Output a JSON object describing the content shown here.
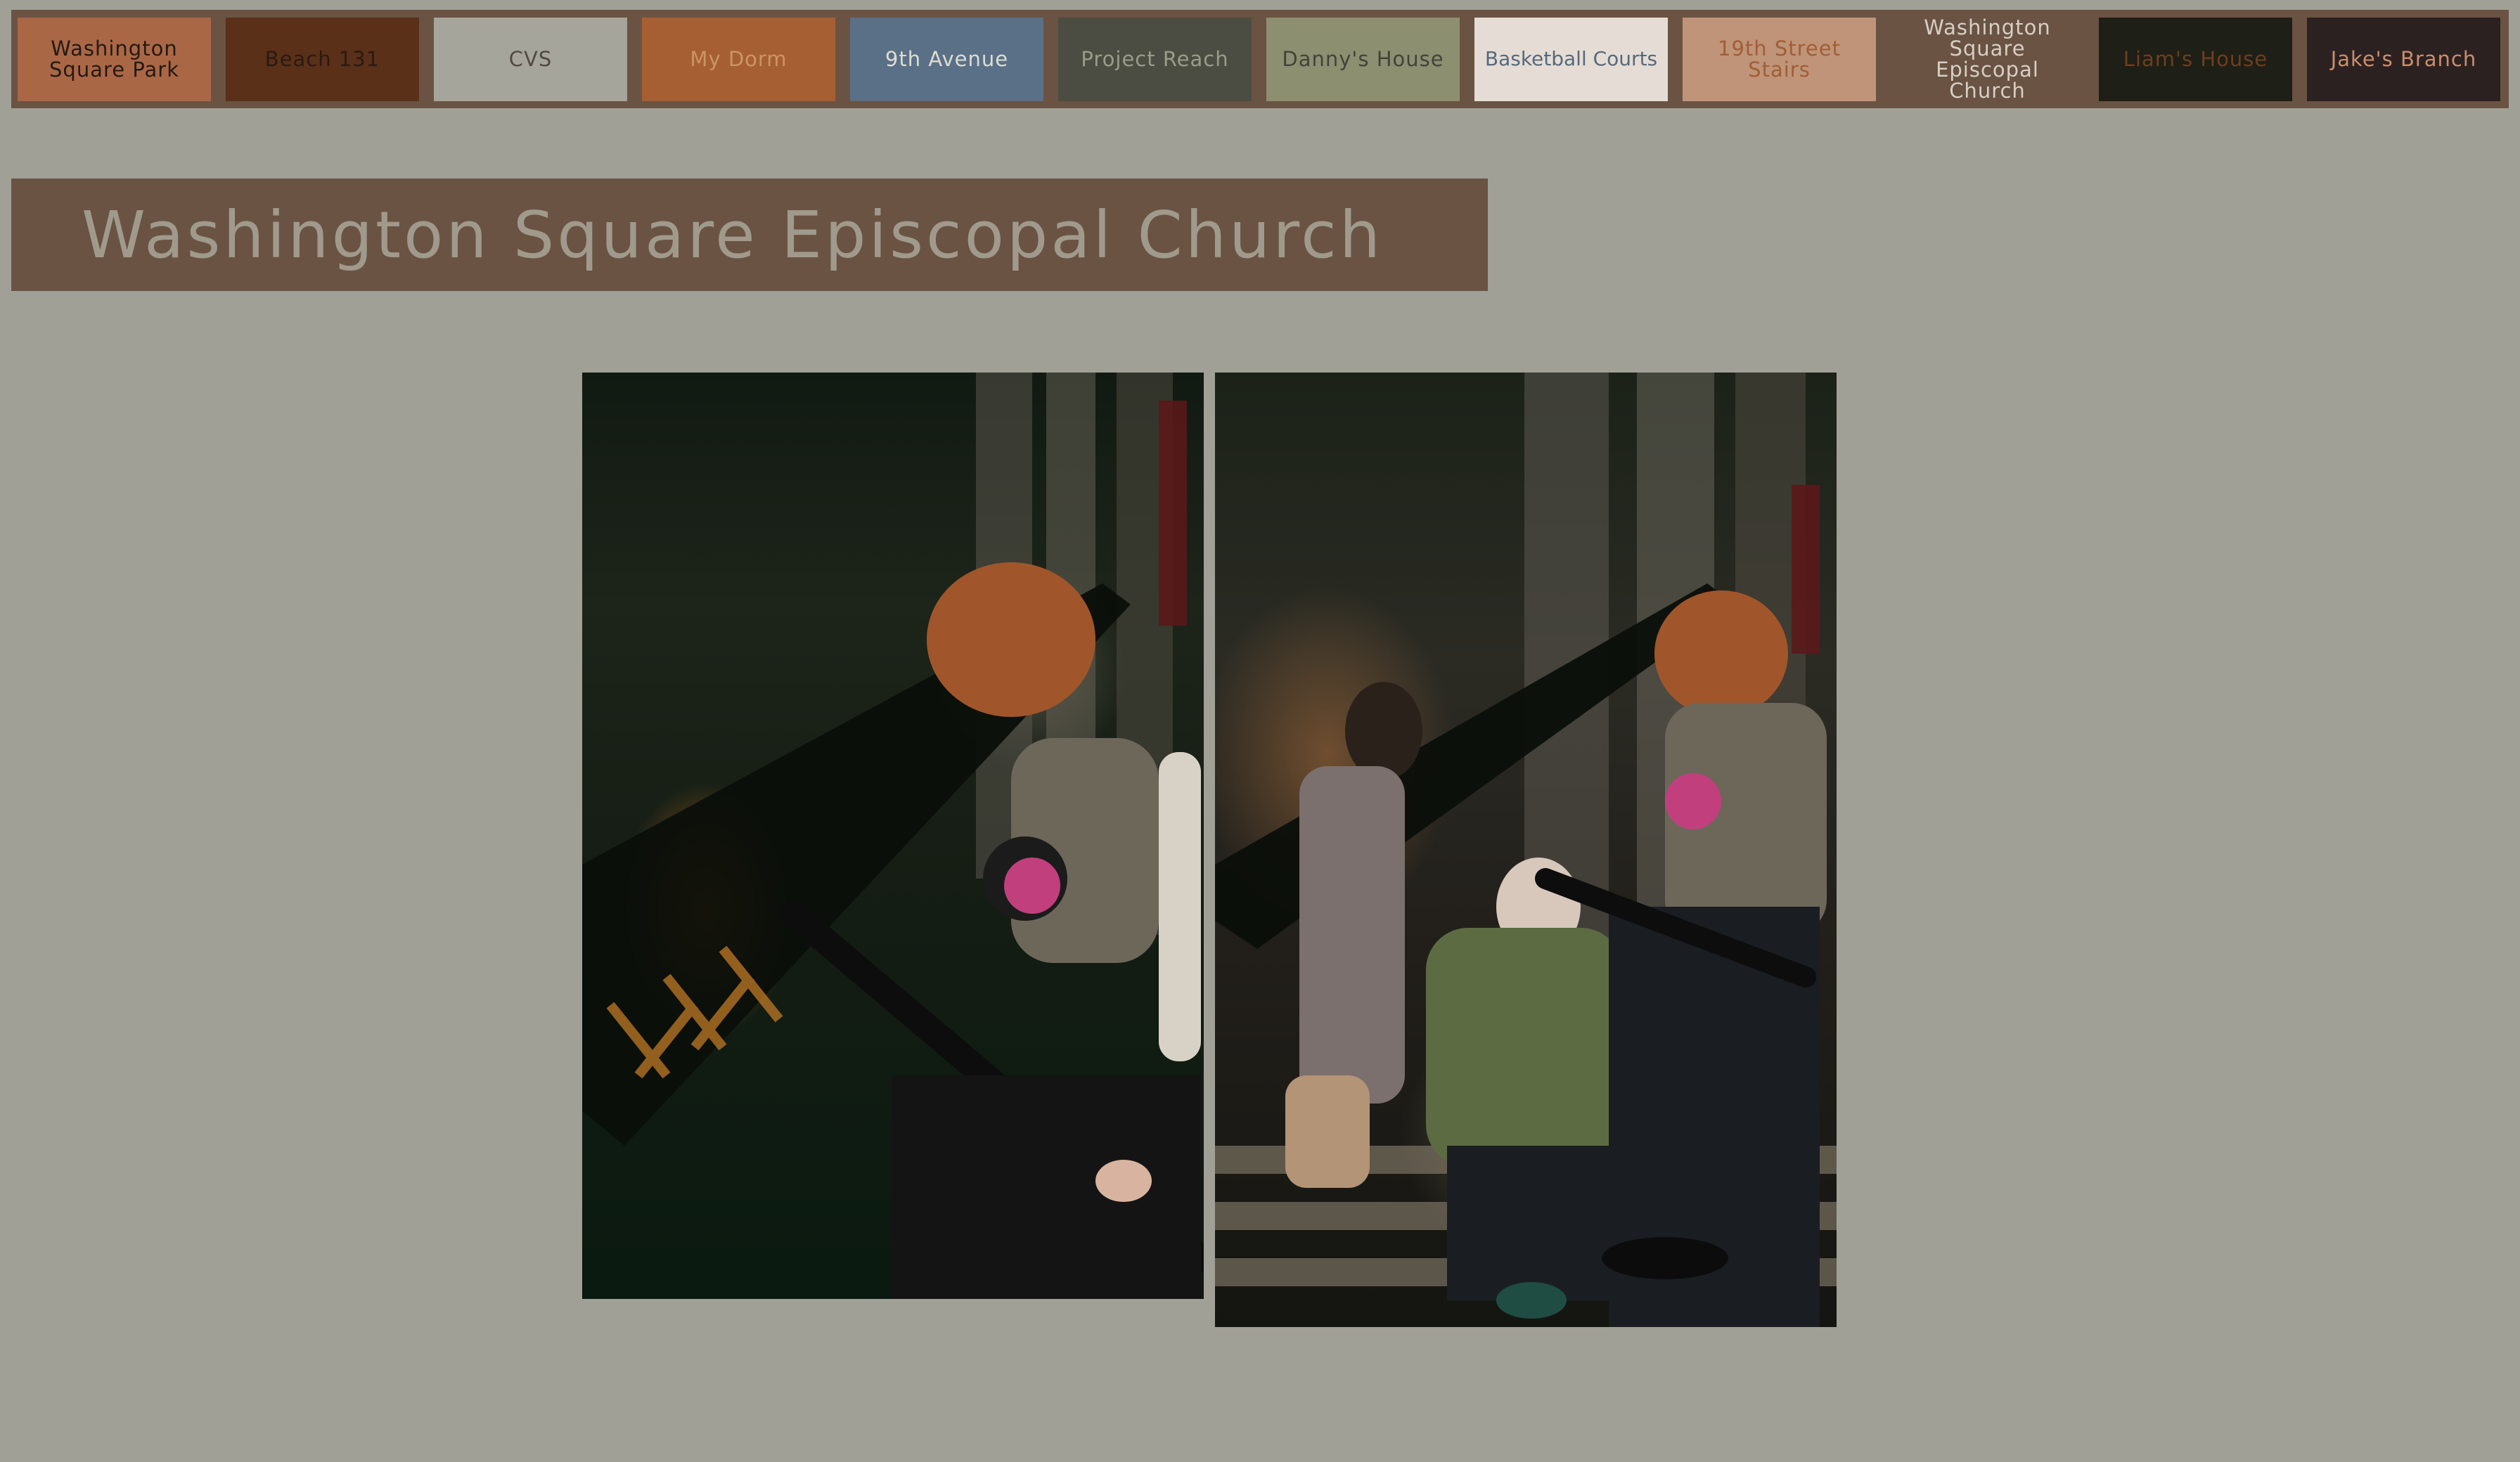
{
  "nav": {
    "items": [
      {
        "label": "Washington Square Park"
      },
      {
        "label": "Beach 131"
      },
      {
        "label": "CVS"
      },
      {
        "label": "My Dorm"
      },
      {
        "label": "9th Avenue"
      },
      {
        "label": "Project Reach"
      },
      {
        "label": "Danny's House"
      },
      {
        "label": "Basketball Courts"
      },
      {
        "label": "19th Street Stairs"
      },
      {
        "label": "Washington Square Episcopal Church"
      },
      {
        "label": "Liam's House"
      },
      {
        "label": "Jake's Branch"
      }
    ]
  },
  "page": {
    "title": "Washington Square Episcopal Church"
  },
  "colors": {
    "page_background": "#a1a097",
    "nav_background": "#6a5343",
    "title_background": "#6a5343",
    "title_text": "#a09a8c"
  }
}
